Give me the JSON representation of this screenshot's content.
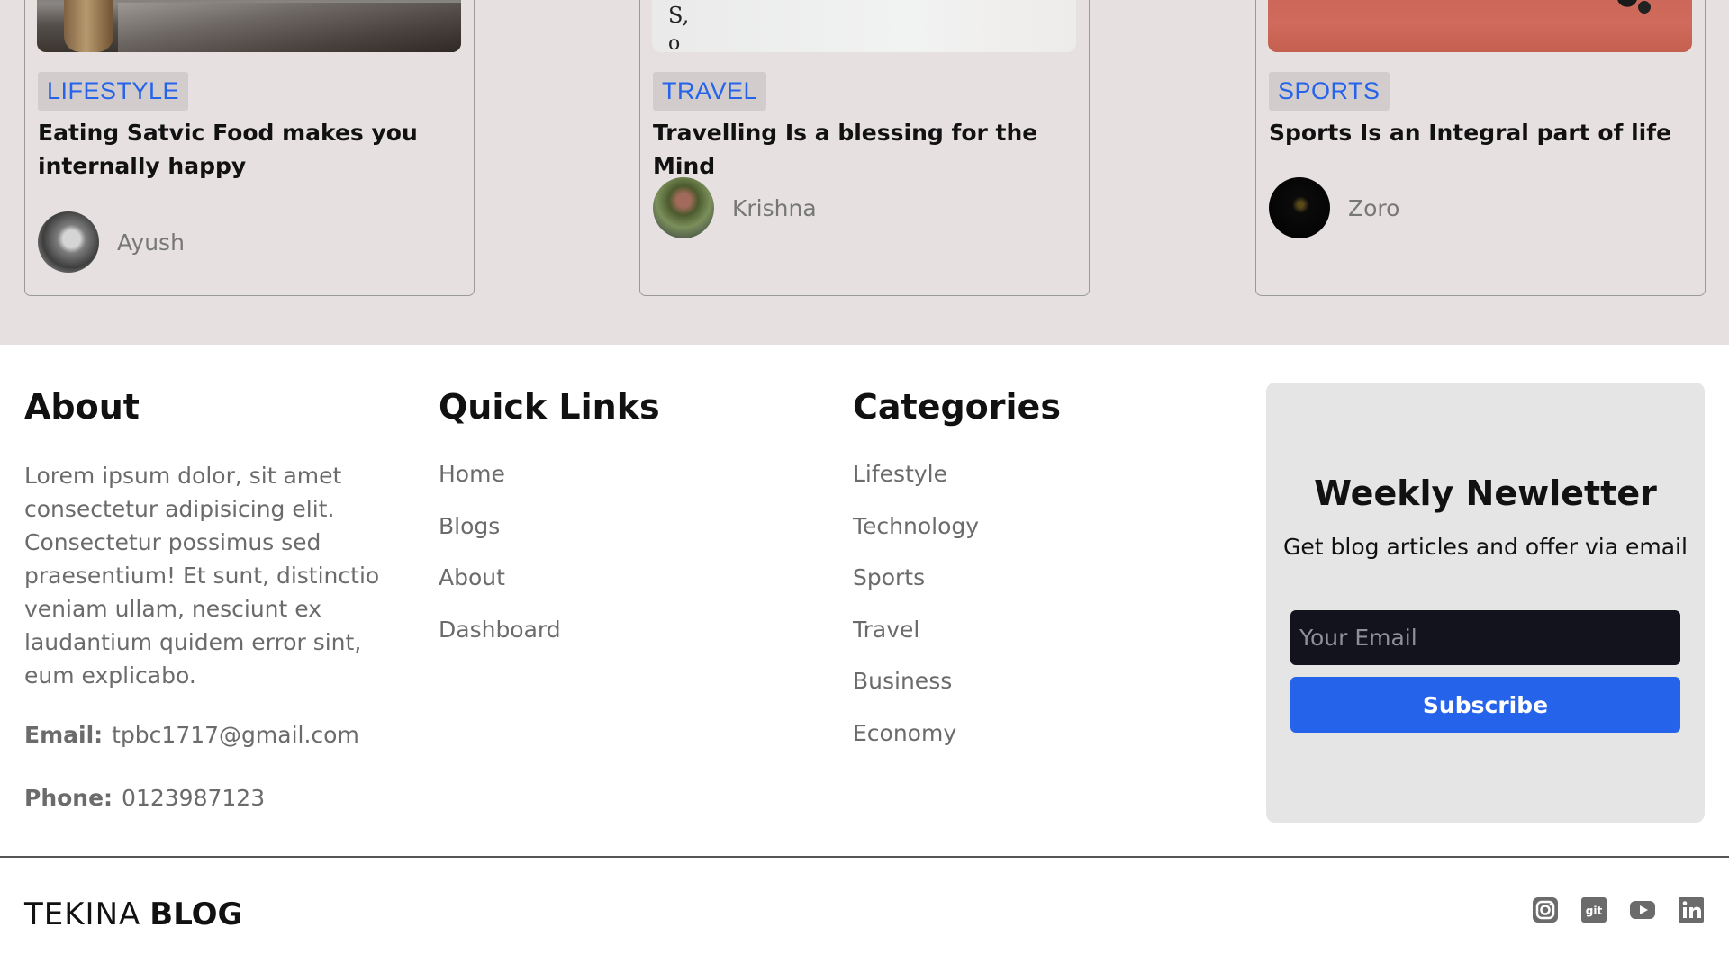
{
  "cards": [
    {
      "tag": "LIFESTYLE",
      "title": "Eating Satvic Food makes you internally happy",
      "author": "Ayush"
    },
    {
      "tag": "TRAVEL",
      "title": "Travelling Is a blessing for the Mind",
      "author": "Krishna",
      "image_text": "S,",
      "image_text_2": "o"
    },
    {
      "tag": "SPORTS",
      "title": "Sports Is an Integral part of life",
      "author": "Zoro"
    }
  ],
  "footer": {
    "about": {
      "heading": "About",
      "text": "Lorem ipsum dolor, sit amet consectetur adipisicing elit. Consectetur possimus sed praesentium! Et sunt, distinctio veniam ullam, nesciunt ex laudantium quidem error sint, eum explicabo.",
      "email_label": "Email:",
      "email": "tpbc1717@gmail.com",
      "phone_label": "Phone:",
      "phone": "0123987123"
    },
    "quick_links": {
      "heading": "Quick Links",
      "items": [
        "Home",
        "Blogs",
        "About",
        "Dashboard"
      ]
    },
    "categories": {
      "heading": "Categories",
      "items": [
        "Lifestyle",
        "Technology",
        "Sports",
        "Travel",
        "Business",
        "Economy"
      ]
    },
    "newsletter": {
      "title": "Weekly Newletter",
      "subtitle": "Get blog articles and offer via email",
      "placeholder": "Your Email",
      "button": "Subscribe"
    },
    "brand": {
      "light": "TEKINA",
      "bold": "BLOG"
    },
    "socials": [
      "instagram-icon",
      "github-icon",
      "youtube-icon",
      "linkedin-icon"
    ]
  },
  "colors": {
    "accent": "#2563eb",
    "cards_background": "#e6e0e0",
    "newsletter_background": "#e5e5e5",
    "input_background": "#13131d",
    "muted_text": "#6b6b6b"
  }
}
